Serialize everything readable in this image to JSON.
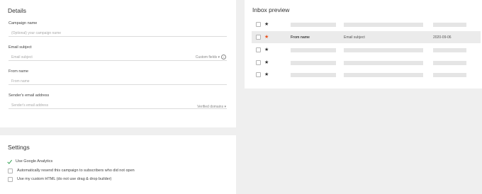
{
  "details": {
    "title": "Details",
    "campaign_name": {
      "label": "Campaign name",
      "placeholder": "(Optional) your campaign name"
    },
    "email_subject": {
      "label": "Email subject",
      "placeholder": "Email subject",
      "aside": "Custom fields ▾",
      "aside_icon": "info-icon"
    },
    "from_name": {
      "label": "From name",
      "placeholder": "From name"
    },
    "sender_email": {
      "label": "Sender's email address",
      "placeholder": "Sender's email address",
      "aside": "Verified domains ▾"
    }
  },
  "settings": {
    "title": "Settings",
    "options": [
      {
        "label": "Use Google Analytics",
        "checked": true
      },
      {
        "label": "Automatically resend this campaign to subscribers who did not open",
        "checked": false
      },
      {
        "label": "Use my custom HTML (do not use drag & drop builder)",
        "checked": false
      }
    ]
  },
  "inbox_preview": {
    "title": "Inbox preview",
    "star_glyph": "★",
    "highlight_star_color": "#e8501c",
    "row_highlight_color": "#ebebeb",
    "preview_row": {
      "from": "From name",
      "subject": "Email subject",
      "date": "2020-09-06"
    }
  },
  "colors": {
    "accent_check": "#2e9e4f",
    "background": "#efefef",
    "card": "#ffffff"
  }
}
